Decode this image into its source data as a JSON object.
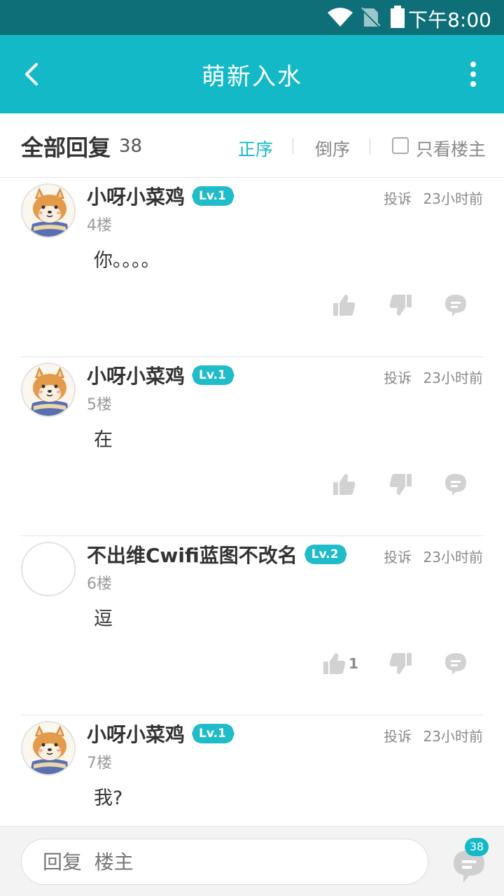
{
  "status_bar": {
    "time": "下午8:00"
  },
  "header": {
    "title": "萌新入水"
  },
  "filter": {
    "all_replies_label": "全部回复",
    "count": "38",
    "sort_asc": "正序",
    "sort_desc": "倒序",
    "owner_only": "只看楼主"
  },
  "posts": [
    {
      "name": "小呀小菜鸡",
      "level": "Lv.1",
      "floor": "4楼",
      "report": "投诉",
      "time": "23小时前",
      "content": "你。。。。",
      "likes": ""
    },
    {
      "name": "小呀小菜鸡",
      "level": "Lv.1",
      "floor": "5楼",
      "report": "投诉",
      "time": "23小时前",
      "content": "在",
      "likes": ""
    },
    {
      "name": "不出维Cwifi蓝图不改名",
      "level": "Lv.2",
      "floor": "6楼",
      "report": "投诉",
      "time": "23小时前",
      "content": "逗",
      "likes": "1"
    },
    {
      "name": "小呀小菜鸡",
      "level": "Lv.1",
      "floor": "7楼",
      "report": "投诉",
      "time": "23小时前",
      "content": "我?",
      "likes": ""
    }
  ],
  "bottom": {
    "reply_placeholder": "回复  楼主",
    "comment_count": "38"
  },
  "colors": {
    "status_bar": "#0e6f79",
    "app_bar": "#14b9c8",
    "accent": "#14b9c8",
    "badge": "#14b9c8"
  }
}
